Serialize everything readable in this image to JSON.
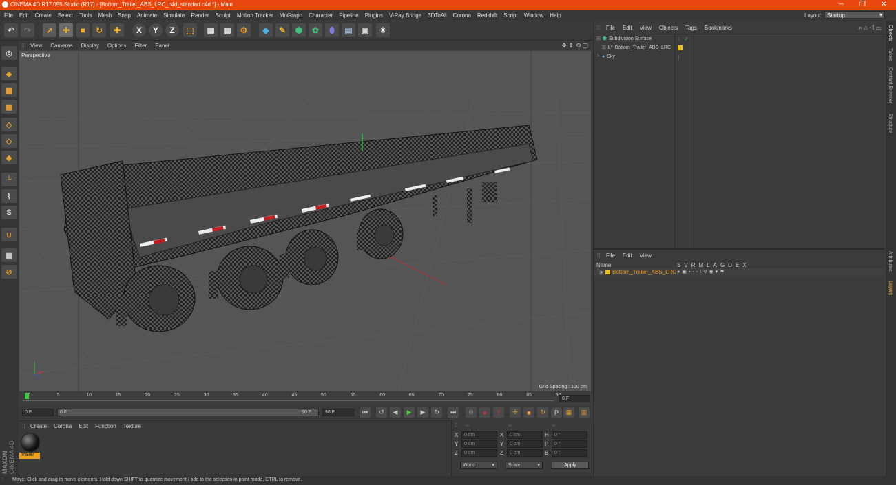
{
  "window": {
    "title": "CINEMA 4D R17.055 Studio (R17) - [Bottom_Trailer_ABS_LRC_c4d_standart.c4d *] - Main"
  },
  "menu": [
    "File",
    "Edit",
    "Create",
    "Select",
    "Tools",
    "Mesh",
    "Snap",
    "Animate",
    "Simulate",
    "Render",
    "Sculpt",
    "Motion Tracker",
    "MoGraph",
    "Character",
    "Pipeline",
    "Plugins",
    "V-Ray Bridge",
    "3DToAll",
    "Corona",
    "Redshift",
    "Script",
    "Window",
    "Help"
  ],
  "layout": {
    "label": "Layout:",
    "value": "Startup"
  },
  "viewport": {
    "menu": [
      "View",
      "Cameras",
      "Display",
      "Options",
      "Filter",
      "Panel"
    ],
    "label": "Perspective",
    "grid_spacing": "Grid Spacing : 100 cm"
  },
  "timeline": {
    "ticks": [
      "0",
      "5",
      "10",
      "15",
      "20",
      "25",
      "30",
      "35",
      "40",
      "45",
      "50",
      "55",
      "60",
      "65",
      "70",
      "75",
      "80",
      "85",
      "90"
    ],
    "current": "0 F"
  },
  "playback": {
    "start": "0 F",
    "slider_start": "0 F",
    "slider_end": "90 F",
    "end": "90 F"
  },
  "material_panel": {
    "menu": [
      "Create",
      "Corona",
      "Edit",
      "Function",
      "Texture"
    ],
    "material_name": "Trailer"
  },
  "coords": {
    "rows": [
      {
        "a": "X",
        "av": "0 cm",
        "b": "X",
        "bv": "0 cm",
        "c": "H",
        "cv": "0 °"
      },
      {
        "a": "Y",
        "av": "0 cm",
        "b": "Y",
        "bv": "0 cm",
        "c": "P",
        "cv": "0 °"
      },
      {
        "a": "Z",
        "av": "0 cm",
        "b": "Z",
        "bv": "0 cm",
        "c": "B",
        "cv": "0 °"
      }
    ],
    "mode": "World",
    "scale": "Scale",
    "apply": "Apply",
    "header1": "--",
    "header2": "--",
    "header3": "--"
  },
  "objects_panel": {
    "menu": [
      "File",
      "Edit",
      "View",
      "Objects",
      "Tags",
      "Bookmarks"
    ],
    "items": [
      "Subdivision Surface",
      "Bottom_Trailer_ABS_LRC",
      "Sky"
    ]
  },
  "layers_panel": {
    "menu": [
      "File",
      "Edit",
      "View"
    ],
    "name_header": "Name",
    "cols": [
      "S",
      "V",
      "R",
      "M",
      "L",
      "A",
      "G",
      "D",
      "E",
      "X"
    ],
    "layer": "Bottom_Trailer_ABS_LRC"
  },
  "side_tabs": [
    "Objects",
    "Takes",
    "Content Browser",
    "Structure",
    "Attributes",
    "Layers"
  ],
  "status": "Move: Click and drag to move elements. Hold down SHIFT to quantize movement / add to the selection in point mode, CTRL to remove.",
  "brand": [
    "MAXON",
    "CINEMA 4D"
  ],
  "colors": {
    "accent": "#e8470f",
    "selected": "#f0a020",
    "layer_dot": "#e8c020"
  }
}
